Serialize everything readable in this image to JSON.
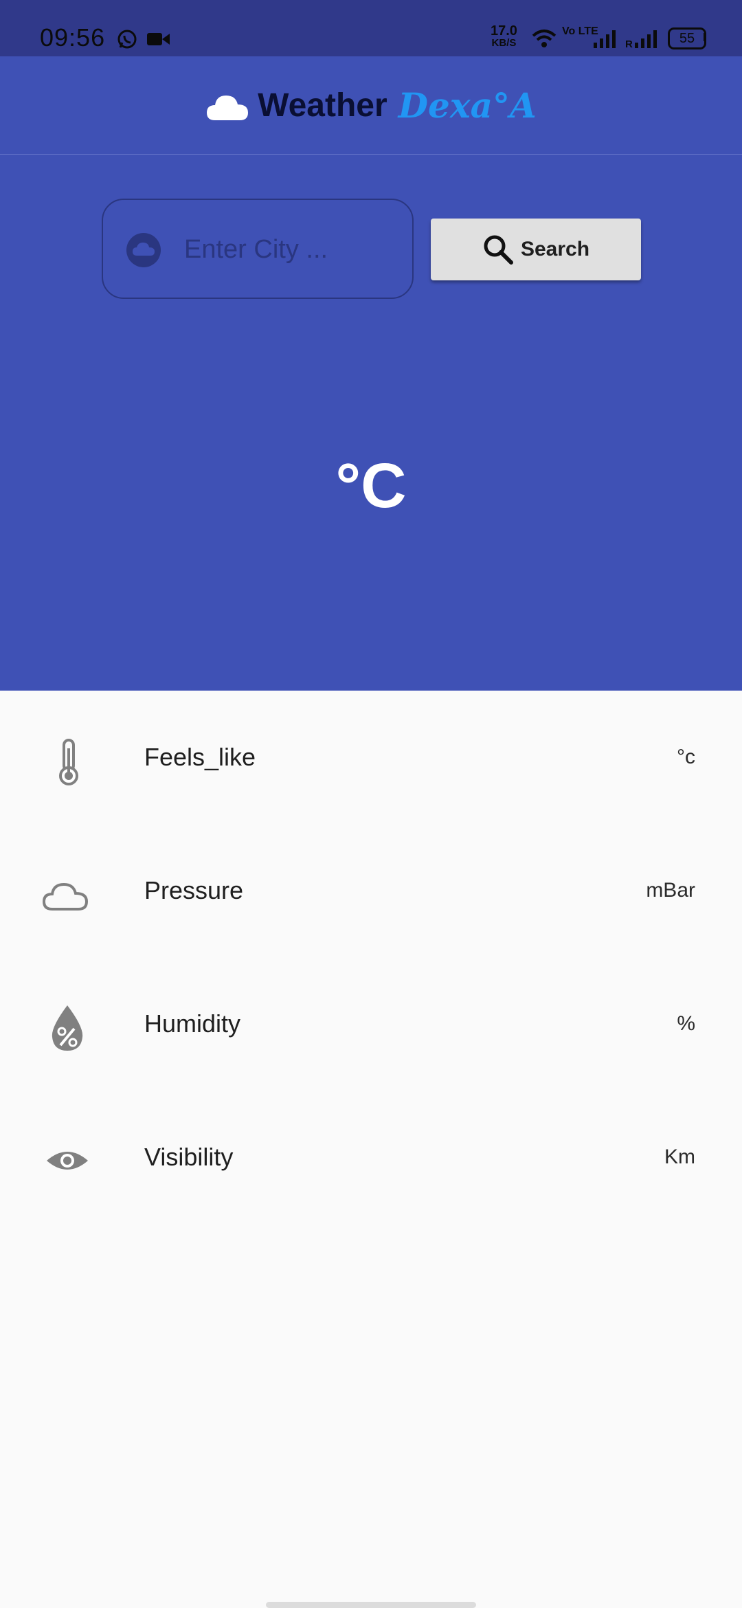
{
  "status_bar": {
    "time": "09:56",
    "speed_value": "17.0",
    "speed_unit": "KB/S",
    "volte": "Vo LTE",
    "roaming": "R",
    "battery": "55"
  },
  "app_bar": {
    "title": "Weather",
    "subtitle": "Dexa°A"
  },
  "search": {
    "placeholder": "Enter City ...",
    "value": "",
    "button_label": "Search"
  },
  "current": {
    "temperature": "",
    "unit": "°C"
  },
  "details": [
    {
      "icon": "thermometer-icon",
      "label": "Feels_like",
      "value": "°c"
    },
    {
      "icon": "cloud-outline-icon",
      "label": "Pressure",
      "value": "mBar"
    },
    {
      "icon": "humidity-drop-icon",
      "label": "Humidity",
      "value": "%"
    },
    {
      "icon": "eye-icon",
      "label": "Visibility",
      "value": "Km"
    }
  ],
  "colors": {
    "primary": "#3f51b5",
    "status_bar": "#30398a",
    "accent": "#2196f3",
    "button": "#e0e0e0",
    "icon_gray": "#808080",
    "background": "#fafafa"
  }
}
